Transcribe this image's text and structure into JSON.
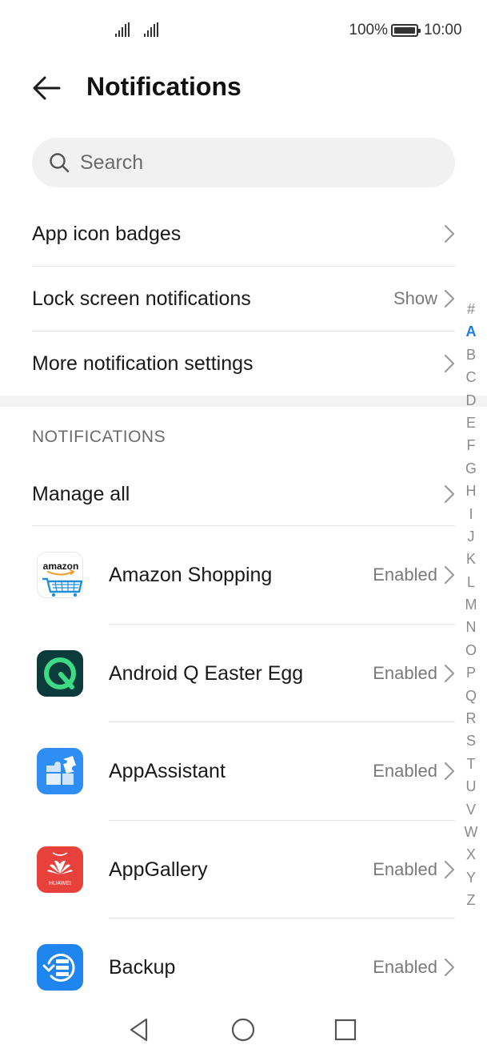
{
  "status_bar": {
    "battery": "100%",
    "time": "10:00"
  },
  "header": {
    "title": "Notifications"
  },
  "search": {
    "placeholder": "Search"
  },
  "settings": [
    {
      "label": "App icon badges",
      "value": ""
    },
    {
      "label": "Lock screen notifications",
      "value": "Show"
    },
    {
      "label": "More notification settings",
      "value": ""
    }
  ],
  "notifications_section": {
    "header": "NOTIFICATIONS",
    "manage_all": "Manage all"
  },
  "apps": [
    {
      "name": "Amazon Shopping",
      "status": "Enabled",
      "icon": "amazon-icon",
      "logo_text": "amazon"
    },
    {
      "name": "Android Q Easter Egg",
      "status": "Enabled",
      "icon": "android-q-icon"
    },
    {
      "name": "AppAssistant",
      "status": "Enabled",
      "icon": "puzzle-icon"
    },
    {
      "name": "AppGallery",
      "status": "Enabled",
      "icon": "huawei-icon",
      "logo_text": "HUAWEI"
    },
    {
      "name": "Backup",
      "status": "Enabled",
      "icon": "backup-icon"
    }
  ],
  "alphabet": [
    "#",
    "A",
    "B",
    "C",
    "D",
    "E",
    "F",
    "G",
    "H",
    "I",
    "J",
    "K",
    "L",
    "M",
    "N",
    "O",
    "P",
    "Q",
    "R",
    "S",
    "T",
    "U",
    "V",
    "W",
    "X",
    "Y",
    "Z"
  ],
  "alphabet_active": "A",
  "colors": {
    "accent": "#1a7ce0",
    "android_q_bg": "#0b3b3a",
    "android_q_fg": "#3ddc84",
    "app_assistant": "#2f8ef4",
    "app_gallery": "#e8403a",
    "backup": "#1f86f0"
  }
}
